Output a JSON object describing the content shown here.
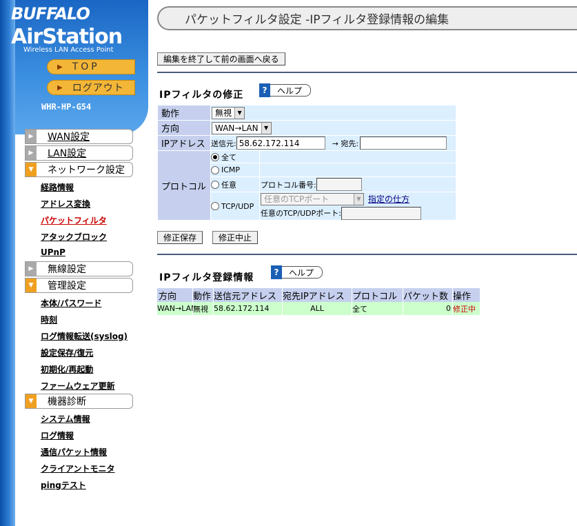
{
  "sidebar": {
    "brand_buffalo": "BUFFALO",
    "brand_airstation": "AirStation",
    "brand_sub": "Wireless LAN Access Point",
    "top_label": "TOP",
    "logout_label": "ログアウト",
    "model": "WHR-HP-G54",
    "sections": {
      "wan": "WAN設定",
      "lan": "LAN設定",
      "network": "ネットワーク設定",
      "wireless": "無線設定",
      "admin": "管理設定",
      "diag": "機器診断"
    },
    "network_links": [
      "経路情報",
      "アドレス変換",
      "パケットフィルタ",
      "アタックブロック",
      "UPnP"
    ],
    "admin_links": [
      "本体/パスワード",
      "時刻",
      "ログ情報転送(syslog)",
      "設定保存/復元",
      "初期化/再起動",
      "ファームウェア更新"
    ],
    "diag_links": [
      "システム情報",
      "ログ情報",
      "通信パケット情報",
      "クライアントモニタ",
      "pingテスト"
    ]
  },
  "main": {
    "title": "パケットフィルタ設定 -IPフィルタ登録情報の編集",
    "back_button": "編集を終了して前の画面へ戻る",
    "edit_title": "IPフィルタの修正",
    "help_label": "ヘルプ",
    "help_q": "?",
    "form": {
      "action_label": "動作",
      "action_value": "無視",
      "direction_label": "方向",
      "direction_value": "WAN→LAN",
      "ip_label": "IPアドレス",
      "src_label": "送信元:",
      "src_value": "58.62.172.114",
      "dst_label": "→ 宛先:",
      "dst_value": "",
      "protocol_label": "プロトコル",
      "opt_all": "全て",
      "opt_icmp": "ICMP",
      "opt_any": "任意",
      "protocol_num_label": "プロトコル番号:",
      "opt_tcpudp": "TCP/UDP",
      "tcp_port_select": "任意のTCPポート",
      "howto_link": "指定の仕方",
      "any_port_label": "任意のTCP/UDPポート:"
    },
    "save_button": "修正保存",
    "cancel_button": "修正中止",
    "list_title": "IPフィルタ登録情報",
    "table": {
      "headers": [
        "方向",
        "動作",
        "送信元アドレス",
        "宛先IPアドレス",
        "プロトコル",
        "パケット数",
        "操作"
      ],
      "row": {
        "direction": "WAN→LAN",
        "action": "無視",
        "src": "58.62.172.114",
        "dst": "ALL",
        "protocol": "全て",
        "packets": "0",
        "status": "修正中"
      }
    }
  },
  "colors": {
    "label_bg": "#c6d0ee",
    "cell_bg": "#dcefff",
    "row_bg": "#ccffcc",
    "accent_orange": "#f3b637",
    "current_link": "#cc0000"
  }
}
